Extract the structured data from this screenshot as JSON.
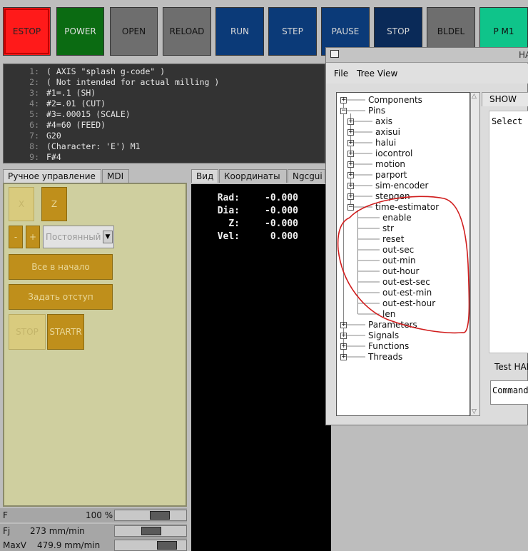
{
  "toolbar": {
    "buttons": [
      {
        "label": "ESTOP",
        "bg": "#ff1a1a",
        "fg": "#222222"
      },
      {
        "label": "POWER",
        "bg": "#0b6b12",
        "fg": "#e0e0e0"
      },
      {
        "label": "OPEN",
        "bg": "#6e6e6e",
        "fg": "#111111"
      },
      {
        "label": "RELOAD",
        "bg": "#6e6e6e",
        "fg": "#111111"
      },
      {
        "label": "RUN",
        "bg": "#0b3a78",
        "fg": "#d8d8d8"
      },
      {
        "label": "STEP",
        "bg": "#0b3a78",
        "fg": "#d8d8d8"
      },
      {
        "label": "PAUSE",
        "bg": "#0b3a78",
        "fg": "#d8d8d8"
      },
      {
        "label": "STOP",
        "bg": "#0a2a58",
        "fg": "#d8d8d8"
      },
      {
        "label": "BLDEL",
        "bg": "#6e6e6e",
        "fg": "#111111"
      },
      {
        "label": "P M1",
        "bg": "#0fc48a",
        "fg": "#111111"
      }
    ]
  },
  "gcode": {
    "lines": [
      {
        "num": "1:",
        "text": "( AXIS \"splash g-code\" )"
      },
      {
        "num": "2:",
        "text": "( Not intended for actual milling )"
      },
      {
        "num": "3:",
        "text": "#1=.1 (SH)"
      },
      {
        "num": "4:",
        "text": "#2=.01 (CUT)"
      },
      {
        "num": "5:",
        "text": "#3=.00015 (SCALE)"
      },
      {
        "num": "6:",
        "text": "#4=60 (FEED)"
      },
      {
        "num": "7:",
        "text": "G20"
      },
      {
        "num": "8:",
        "text": "(Character: 'E') M1"
      },
      {
        "num": "9:",
        "text": "F#4"
      }
    ]
  },
  "left_tabs": {
    "manual": "Ручное управление",
    "mdi": "MDI"
  },
  "manual": {
    "axis_x": "X",
    "axis_z": "Z",
    "minus": "-",
    "plus": "+",
    "jog_mode": "Постоянный",
    "home_all": "Все в начало",
    "touch_off": "Задать отступ",
    "stop": "STOP",
    "start": "STARTR"
  },
  "sliders": {
    "feed": {
      "label": "F",
      "value": "100 %",
      "level": 0.72
    },
    "jog": {
      "label": "Fj",
      "value": "273 mm/min",
      "level": 0.55
    },
    "maxv": {
      "label": "MaxV",
      "value": "479.9 mm/min",
      "level": 0.87
    }
  },
  "preview_tabs": {
    "view": "Вид",
    "coords": "Координаты",
    "ngcgui": "Ngcgui"
  },
  "dro": [
    {
      "label": "Rad:",
      "value": "-0.000"
    },
    {
      "label": "Dia:",
      "value": "-0.000"
    },
    {
      "label": "Z:",
      "value": "-0.000"
    },
    {
      "label": "Vel:",
      "value": "0.000"
    }
  ],
  "hal": {
    "title_partial": "HA",
    "menu": {
      "file": "File",
      "tree_view": "Tree View"
    },
    "tab_show": "SHOW",
    "select_text": "Select a",
    "test_label": "Test HAI",
    "commands_placeholder": "Commands",
    "annotation_color": "#d01c1c",
    "tree": [
      {
        "label": "Components",
        "depth": 0,
        "box": "+"
      },
      {
        "label": "Pins",
        "depth": 0,
        "box": "-"
      },
      {
        "label": "axis",
        "depth": 1,
        "box": "+"
      },
      {
        "label": "axisui",
        "depth": 1,
        "box": "+"
      },
      {
        "label": "halui",
        "depth": 1,
        "box": "+"
      },
      {
        "label": "iocontrol",
        "depth": 1,
        "box": "+"
      },
      {
        "label": "motion",
        "depth": 1,
        "box": "+"
      },
      {
        "label": "parport",
        "depth": 1,
        "box": "+"
      },
      {
        "label": "sim-encoder",
        "depth": 1,
        "box": "+"
      },
      {
        "label": "stepgen",
        "depth": 1,
        "box": "+"
      },
      {
        "label": "time-estimator",
        "depth": 1,
        "box": "-"
      },
      {
        "label": "enable",
        "depth": 2,
        "box": ""
      },
      {
        "label": "str",
        "depth": 2,
        "box": ""
      },
      {
        "label": "reset",
        "depth": 2,
        "box": ""
      },
      {
        "label": "out-sec",
        "depth": 2,
        "box": ""
      },
      {
        "label": "out-min",
        "depth": 2,
        "box": ""
      },
      {
        "label": "out-hour",
        "depth": 2,
        "box": ""
      },
      {
        "label": "out-est-sec",
        "depth": 2,
        "box": ""
      },
      {
        "label": "out-est-min",
        "depth": 2,
        "box": ""
      },
      {
        "label": "out-est-hour",
        "depth": 2,
        "box": ""
      },
      {
        "label": "len",
        "depth": 2,
        "box": ""
      },
      {
        "label": "Parameters",
        "depth": 0,
        "box": "+"
      },
      {
        "label": "Signals",
        "depth": 0,
        "box": "+"
      },
      {
        "label": "Functions",
        "depth": 0,
        "box": "+"
      },
      {
        "label": "Threads",
        "depth": 0,
        "box": "+"
      }
    ]
  }
}
